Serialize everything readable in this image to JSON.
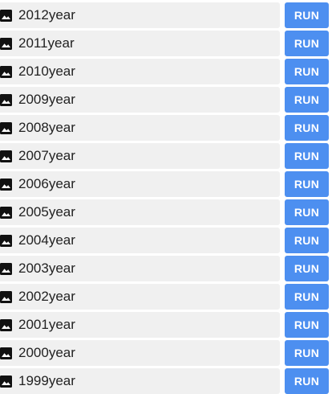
{
  "rows": [
    {
      "label": "2012year",
      "button": "RUN"
    },
    {
      "label": "2011year",
      "button": "RUN"
    },
    {
      "label": "2010year",
      "button": "RUN"
    },
    {
      "label": "2009year",
      "button": "RUN"
    },
    {
      "label": "2008year",
      "button": "RUN"
    },
    {
      "label": "2007year",
      "button": "RUN"
    },
    {
      "label": "2006year",
      "button": "RUN"
    },
    {
      "label": "2005year",
      "button": "RUN"
    },
    {
      "label": "2004year",
      "button": "RUN"
    },
    {
      "label": "2003year",
      "button": "RUN"
    },
    {
      "label": "2002year",
      "button": "RUN"
    },
    {
      "label": "2001year",
      "button": "RUN"
    },
    {
      "label": "2000year",
      "button": "RUN"
    },
    {
      "label": "1999year",
      "button": "RUN"
    }
  ],
  "icon": "image-icon",
  "colors": {
    "row_background": "#f0f0f0",
    "button_background": "#4d8ff0",
    "button_text": "#ffffff",
    "label_text": "#222222",
    "icon": "#111111"
  }
}
